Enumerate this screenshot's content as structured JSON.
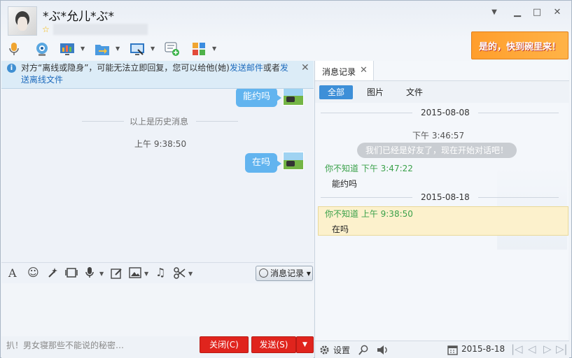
{
  "contact": {
    "name": "*ぶ*允儿*ぶ*"
  },
  "window": {
    "minimize": "▁",
    "restore": "□",
    "close": "✕",
    "menu": "▼"
  },
  "ad": {
    "text": "是的，快到碗里来！"
  },
  "notice": {
    "text_before": "对方“离线或隐身”，可能无法立即回复，您可以给他(她)",
    "link1": "发送邮件",
    "text_mid": "或者",
    "link2": "发送离线文件",
    "close": "✕"
  },
  "chat": {
    "messages": [
      {
        "text": "能约吗"
      },
      {
        "text": "在吗"
      }
    ],
    "history_label": "以上是历史消息",
    "time_label": "上午 9:38:50"
  },
  "input_toolbar": {
    "font": "A",
    "emoji": "☺",
    "music": "♫",
    "msg_record_label": "消息记录",
    "caret": "▾"
  },
  "input": {
    "tip": "扒！男女寝那些不能说的秘密…"
  },
  "buttons": {
    "close": "关闭(C)",
    "send": "发送(S)",
    "send_menu": "▼"
  },
  "panel": {
    "tab_label": "消息记录",
    "tab_close": "✕",
    "filters": [
      "全部",
      "图片",
      "文件"
    ],
    "records": {
      "date1": "2015-08-08",
      "time1": "下午 3:46:57",
      "system_message": "我们已经是好友了，现在开始对话吧！",
      "entry1_header": "你不知道 下午 3:47:22",
      "entry1_text": "能约吗",
      "date2": "2015-08-18",
      "entry2_header": "你不知道 上午 9:38:50",
      "entry2_text": "在吗"
    },
    "footer": {
      "settings_label": "设置",
      "date": "2015-8-18",
      "nav": [
        "|◁",
        "◁",
        "▷",
        "▷|"
      ]
    }
  },
  "colors": {
    "accent": "#3d8fd8",
    "bubble": "#62b4ef",
    "send_red": "#e0241d",
    "green_name": "#3aa14a"
  }
}
